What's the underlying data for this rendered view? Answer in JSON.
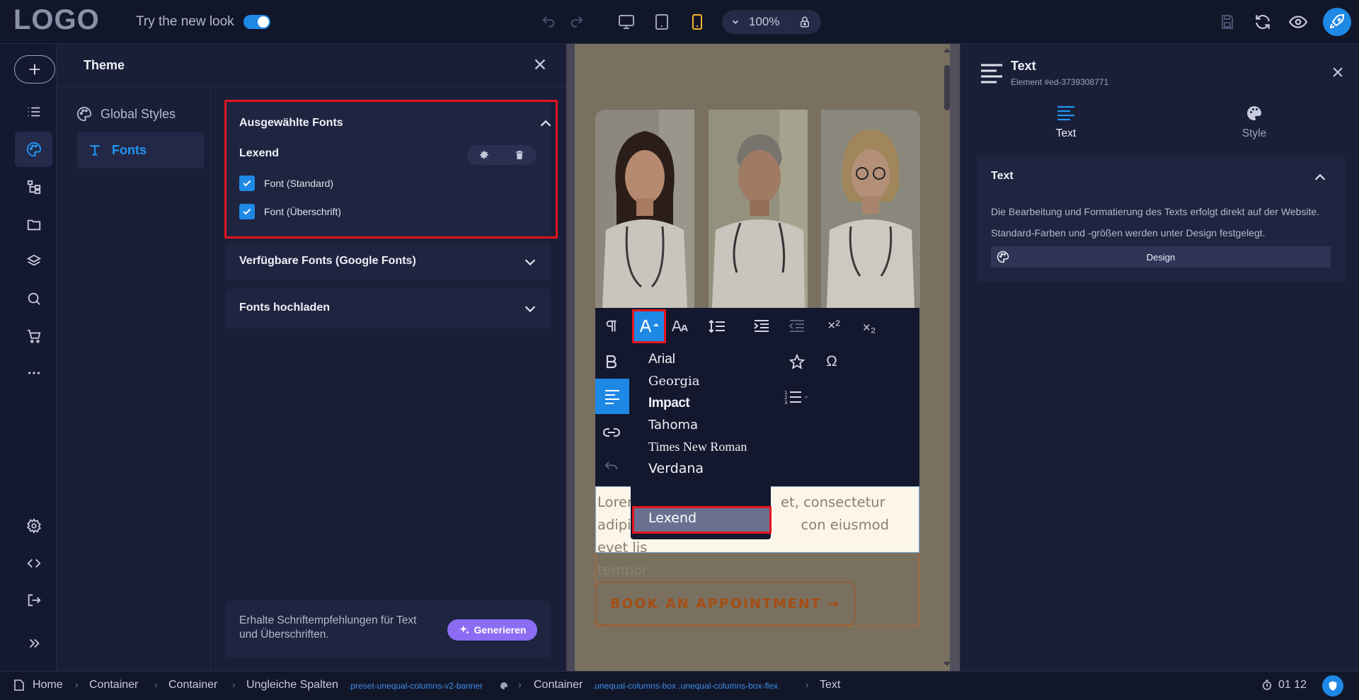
{
  "topbar": {
    "logo": "LOGO",
    "new_look_label": "Try the new look",
    "zoom": "100%"
  },
  "theme_panel": {
    "title": "Theme",
    "nav": {
      "global_styles": "Global Styles",
      "fonts": "Fonts"
    },
    "selected_fonts": {
      "title": "Ausgewählte Fonts",
      "font_name": "Lexend",
      "checkboxes": [
        {
          "label": "Font (Standard)",
          "checked": true
        },
        {
          "label": "Font (Überschrift)",
          "checked": true
        }
      ]
    },
    "available_fonts_title": "Verfügbare Fonts (Google Fonts)",
    "upload_fonts_title": "Fonts hochladen",
    "generate": {
      "text": "Erhalte Schriftempfehlungen für Text und Überschriften.",
      "button": "Generieren"
    }
  },
  "canvas": {
    "text_body": "Lorem ipsum dolor sit amet, consectetur adipiscing elit, sed do con eiusmod evet lis tempor.",
    "text_visible_a": "Lorem",
    "text_visible_b": "et, consectetur",
    "text_visible_c": "adipi",
    "text_visible_d": "con eiusmod evet lis",
    "text_visible_e": "tempor.",
    "book_button": "BOOK AN APPOINTMENT →",
    "toolbar": {
      "superscript": "×²",
      "subscript": "×₂",
      "omega": "Ω"
    },
    "font_menu": {
      "items": [
        "Arial",
        "Georgia",
        "Impact",
        "Tahoma",
        "Times New Roman",
        "Verdana",
        "Lexend"
      ],
      "selected": "Lexend"
    }
  },
  "right_panel": {
    "title": "Text",
    "subtitle": "Element #ed-3739308771",
    "tabs": {
      "text": "Text",
      "style": "Style"
    },
    "section_title": "Text",
    "description_1": "Die Bearbeitung und Formatierung des Texts erfolgt direkt auf der Website.",
    "description_2": "Standard-Farben und -größen werden unter Design festgelegt.",
    "design_button": "Design"
  },
  "statusbar": {
    "crumbs": {
      "home": "Home",
      "container1": "Container",
      "container2": "Container",
      "columns": "Ungleiche Spalten",
      "columns_class": ".preset-unequal-columns-v2-banner",
      "container3": "Container",
      "container3_class": ".unequal-columns-box .unequal-columns-box-flex",
      "text": "Text"
    },
    "timer": "01 12"
  },
  "colors": {
    "accent": "#1e88e5",
    "highlight": "#e3151c",
    "generate": "#8b6cf3",
    "brand_orange": "#a44e14"
  }
}
